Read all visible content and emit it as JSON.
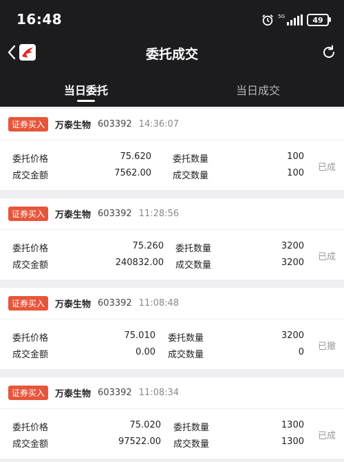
{
  "status_bar": {
    "time": "16:48",
    "battery": "49"
  },
  "nav": {
    "title": "委托成交"
  },
  "tabs": [
    {
      "label": "当日委托",
      "active": true
    },
    {
      "label": "当日成交",
      "active": false
    }
  ],
  "labels": {
    "order_price": "委托价格",
    "order_qty": "委托数量",
    "deal_amount": "成交金额",
    "deal_qty": "成交数量"
  },
  "orders": [
    {
      "type": "证券买入",
      "name": "万泰生物",
      "code": "603392",
      "time": "14:36:07",
      "price": "75.620",
      "order_qty": "100",
      "amount": "7562.00",
      "deal_qty": "100",
      "status": "已成"
    },
    {
      "type": "证券买入",
      "name": "万泰生物",
      "code": "603392",
      "time": "11:28:56",
      "price": "75.260",
      "order_qty": "3200",
      "amount": "240832.00",
      "deal_qty": "3200",
      "status": "已成"
    },
    {
      "type": "证券买入",
      "name": "万泰生物",
      "code": "603392",
      "time": "11:08:48",
      "price": "75.010",
      "order_qty": "3200",
      "amount": "0.00",
      "deal_qty": "0",
      "status": "已撤"
    },
    {
      "type": "证券买入",
      "name": "万泰生物",
      "code": "603392",
      "time": "11:08:34",
      "price": "75.020",
      "order_qty": "1300",
      "amount": "97522.00",
      "deal_qty": "1300",
      "status": "已成"
    }
  ],
  "colors": {
    "header_bg": "#1c1c1e",
    "badge": "#e7553a",
    "page_bg": "#efeff1"
  }
}
